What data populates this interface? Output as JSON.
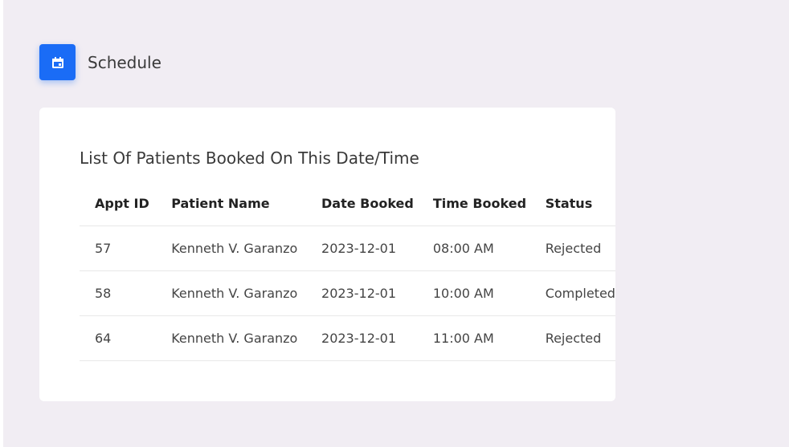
{
  "header": {
    "title": "Schedule",
    "icon": "calendar-icon",
    "accent_color": "#1a6cf6"
  },
  "card": {
    "title": "List Of Patients Booked On This Date/Time",
    "columns": [
      "Appt ID",
      "Patient Name",
      "Date Booked",
      "Time Booked",
      "Status"
    ],
    "rows": [
      {
        "id": "57",
        "name": "Kenneth V. Garanzo",
        "date": "2023-12-01",
        "time": "08:00 AM",
        "status": "Rejected"
      },
      {
        "id": "58",
        "name": "Kenneth V. Garanzo",
        "date": "2023-12-01",
        "time": "10:00 AM",
        "status": "Completed"
      },
      {
        "id": "64",
        "name": "Kenneth V. Garanzo",
        "date": "2023-12-01",
        "time": "11:00 AM",
        "status": "Rejected"
      }
    ]
  }
}
